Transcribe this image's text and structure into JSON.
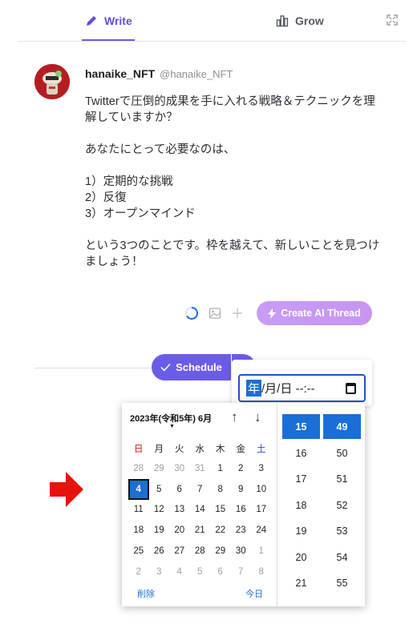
{
  "tabs": {
    "write": "Write",
    "grow": "Grow"
  },
  "tweet": {
    "name": "hanaike_NFT",
    "handle": "@hanaike_NFT",
    "text": "Twitterで圧倒的成果を手に入れる戦略＆テクニックを理解していますか？\n\nあなたにとって必要なのは、\n\n1）定期的な挑戦\n2）反復\n3）オープンマインド\n\nという3つのことです。枠を越えて、新しいことを見つけましょう！"
  },
  "composer": {
    "ai_button": "Create AI Thread"
  },
  "schedule": {
    "label": "Schedule"
  },
  "datetime_input": {
    "year": "年",
    "rest": "/月/日 --:--"
  },
  "calendar": {
    "month_label": "2023年(令和5年) 6月",
    "weekdays": [
      "日",
      "月",
      "火",
      "水",
      "木",
      "金",
      "土"
    ],
    "weeks": [
      [
        "28",
        "29",
        "30",
        "31",
        "1",
        "2",
        "3"
      ],
      [
        "4",
        "5",
        "6",
        "7",
        "8",
        "9",
        "10"
      ],
      [
        "11",
        "12",
        "13",
        "14",
        "15",
        "16",
        "17"
      ],
      [
        "18",
        "19",
        "20",
        "21",
        "22",
        "23",
        "24"
      ],
      [
        "25",
        "26",
        "27",
        "28",
        "29",
        "30",
        "1"
      ],
      [
        "2",
        "3",
        "4",
        "5",
        "6",
        "7",
        "8"
      ]
    ],
    "selected_day": "4",
    "clear_label": "削除",
    "today_label": "今日",
    "hours": [
      "15",
      "16",
      "17",
      "18",
      "19",
      "20",
      "21"
    ],
    "minutes": [
      "49",
      "50",
      "51",
      "52",
      "53",
      "54",
      "55"
    ],
    "selected_hour": "15",
    "selected_minute": "49"
  },
  "colors": {
    "accent": "#6b5ce7",
    "ai_gradient": "#c79cf4",
    "date_select": "#1a6fd6",
    "arrow": "#e8120c"
  }
}
